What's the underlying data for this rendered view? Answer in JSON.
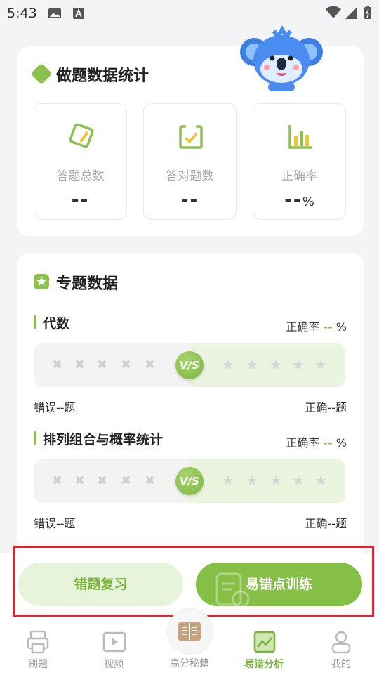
{
  "status_bar": {
    "time": "5:43"
  },
  "stats": {
    "title": "做题数据统计",
    "boxes": [
      {
        "label": "答题总数",
        "value": "--",
        "unit": ""
      },
      {
        "label": "答对题数",
        "value": "--",
        "unit": ""
      },
      {
        "label": "正确率",
        "value": "--",
        "unit": "%"
      }
    ]
  },
  "topics": {
    "title": "专题数据",
    "rate_label": "正确率",
    "rate_value": "--",
    "rate_unit": "%",
    "vs_text": "V/S",
    "items": [
      {
        "name": "代数",
        "wrong": "错误--题",
        "correct": "正确--题"
      },
      {
        "name": "排列组合与概率统计",
        "wrong": "错误--题",
        "correct": "正确--题"
      }
    ]
  },
  "actions": {
    "review_label": "错题复习",
    "train_label": "易错点训练"
  },
  "tabbar": {
    "items": [
      {
        "label": "刷题",
        "icon": "printer-icon"
      },
      {
        "label": "视频",
        "icon": "video-icon"
      },
      {
        "label": "高分秘籍",
        "icon": "book-icon"
      },
      {
        "label": "易错分析",
        "icon": "chart-icon"
      },
      {
        "label": "我的",
        "icon": "user-icon"
      }
    ],
    "active_index": 3
  },
  "colors": {
    "accent": "#86bf46",
    "accent_light": "#e8f3dc",
    "highlight_frame": "#e5212a"
  }
}
